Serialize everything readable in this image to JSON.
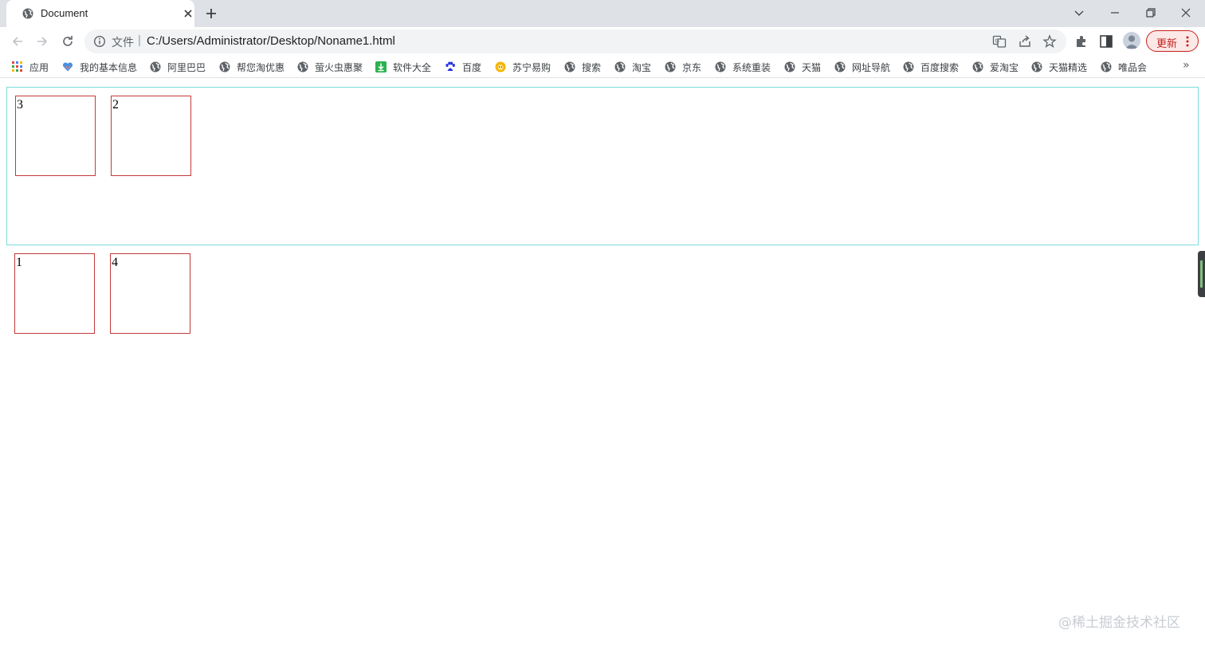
{
  "tab": {
    "title": "Document"
  },
  "address_bar": {
    "chip": "文件",
    "separator": "|",
    "url": "C:/Users/Administrator/Desktop/Noname1.html"
  },
  "update_button": {
    "label": "更新"
  },
  "bookmarks": [
    {
      "label": "应用",
      "icon": "apps-grid-icon"
    },
    {
      "label": "我的基本信息",
      "icon": "heart-icon"
    },
    {
      "label": "阿里巴巴",
      "icon": "globe-icon"
    },
    {
      "label": "帮您淘优惠",
      "icon": "globe-icon"
    },
    {
      "label": "萤火虫惠聚",
      "icon": "globe-icon"
    },
    {
      "label": "软件大全",
      "icon": "download-icon"
    },
    {
      "label": "百度",
      "icon": "baidu-paw-icon"
    },
    {
      "label": "苏宁易购",
      "icon": "suning-lion-icon"
    },
    {
      "label": "搜索",
      "icon": "globe-icon"
    },
    {
      "label": "淘宝",
      "icon": "globe-icon"
    },
    {
      "label": "京东",
      "icon": "globe-icon"
    },
    {
      "label": "系统重装",
      "icon": "globe-icon"
    },
    {
      "label": "天猫",
      "icon": "globe-icon"
    },
    {
      "label": "网址导航",
      "icon": "globe-icon"
    },
    {
      "label": "百度搜索",
      "icon": "globe-icon"
    },
    {
      "label": "爱淘宝",
      "icon": "globe-icon"
    },
    {
      "label": "天猫精选",
      "icon": "globe-icon"
    },
    {
      "label": "唯品会",
      "icon": "globe-icon"
    }
  ],
  "bookmarks_overflow": "»",
  "page": {
    "container_boxes": [
      "3",
      "2"
    ],
    "outside_boxes": [
      "1",
      "4"
    ]
  },
  "watermark": "@稀土掘金技术社区",
  "colors": {
    "container_border": "#7fdcdc",
    "box_border": "#c23a3a",
    "update_accent": "#c5221f"
  }
}
